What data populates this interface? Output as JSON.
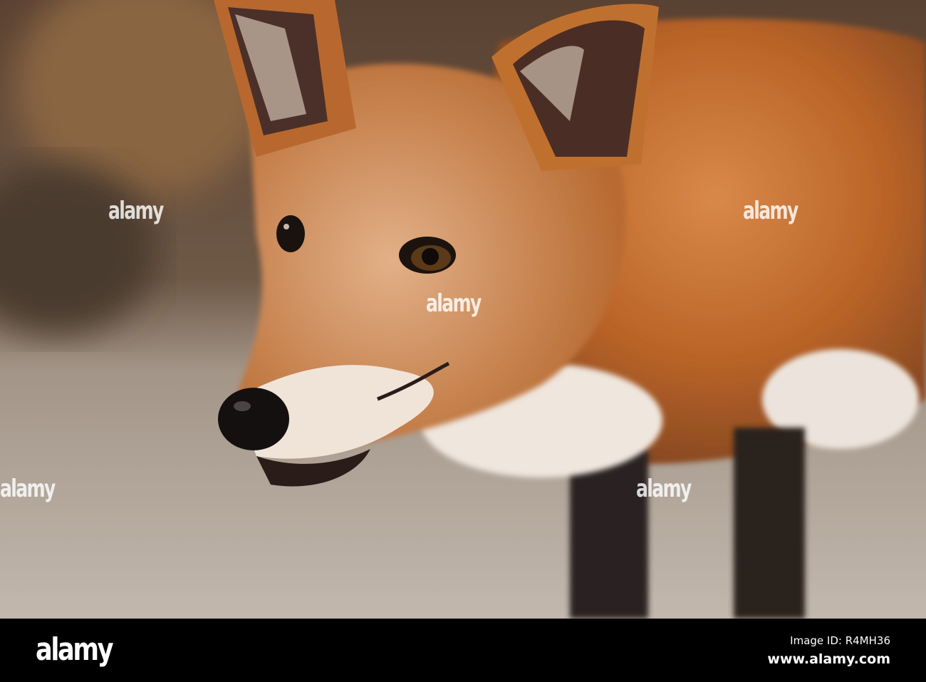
{
  "photo": {
    "subject": "red fox portrait",
    "watermark_text": "alamy"
  },
  "footer": {
    "logo": "alamy",
    "image_id": "Image ID: R4MH36",
    "website": "www.alamy.com"
  },
  "colors": {
    "fur": "#c06a2c",
    "background": "#6b5340",
    "floor": "#b8aea4"
  }
}
